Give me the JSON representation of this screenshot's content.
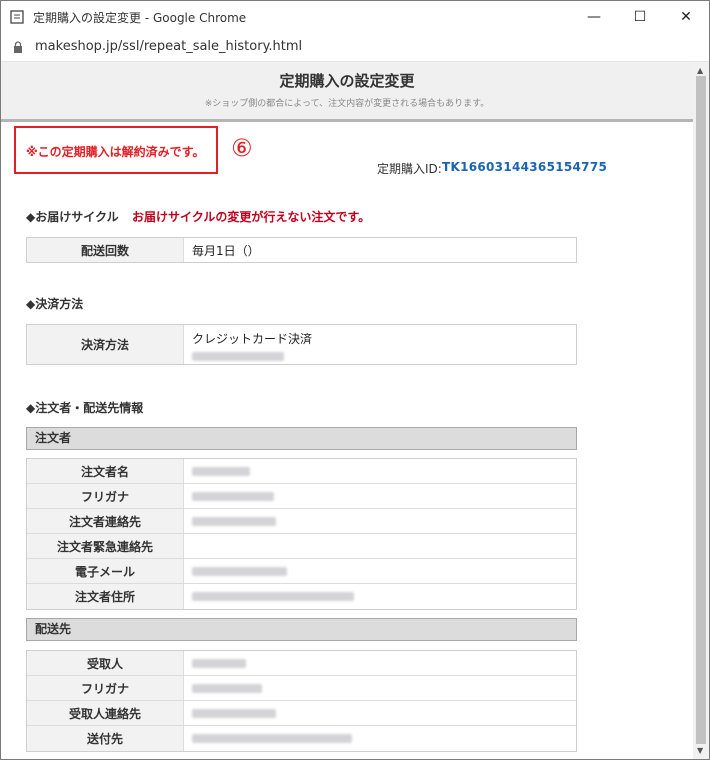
{
  "window": {
    "title": "定期購入の設定変更 - Google Chrome",
    "minimize": "—",
    "maximize": "☐",
    "close": "✕"
  },
  "address": {
    "url": "makeshop.jp/ssl/repeat_sale_history.html"
  },
  "header": {
    "title": "定期購入の設定変更",
    "note": "※ショップ側の都合によって、注文内容が変更される場合もあります。"
  },
  "notice": {
    "cancelled_text": "※この定期購入は解約済みです。",
    "marker": "⑥"
  },
  "repeat_id": {
    "label": "定期購入ID:",
    "value": "TK16603144365154775"
  },
  "delivery_cycle": {
    "heading": "◆お届けサイクル",
    "warning": "お届けサイクルの変更が行えない注文です。",
    "rows": [
      {
        "label": "配送回数",
        "value": "毎月1日（）"
      }
    ]
  },
  "payment": {
    "heading": "◆決済方法",
    "label": "決済方法",
    "value": "クレジットカード決済"
  },
  "orderer_info": {
    "heading": "◆注文者・配送先情報",
    "orderer_header": "注文者",
    "orderer_rows": [
      "注文者名",
      "フリガナ",
      "注文者連絡先",
      "注文者緊急連絡先",
      "電子メール",
      "注文者住所"
    ],
    "delivery_header": "配送先",
    "delivery_rows": [
      "受取人",
      "フリガナ",
      "受取人連絡先",
      "送付先"
    ]
  },
  "scrollbar": {
    "up": "▲",
    "down": "▼"
  }
}
